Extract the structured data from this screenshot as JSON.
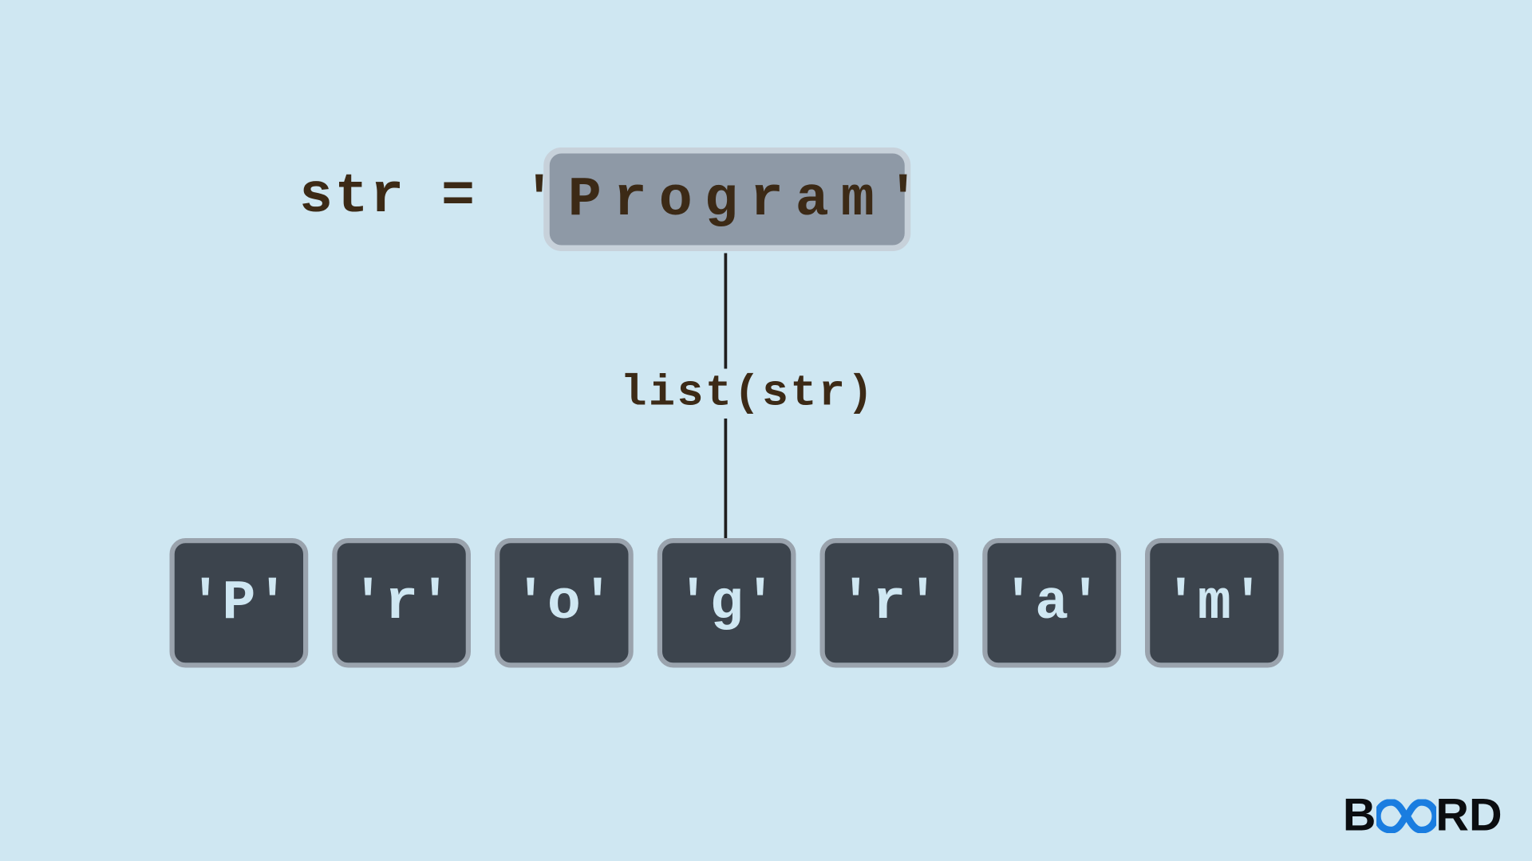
{
  "assignment_label": "str =",
  "string_value": "'Program'",
  "operation_label": "list(str)",
  "chars": [
    "'P'",
    "'r'",
    "'o'",
    "'g'",
    "'r'",
    "'a'",
    "'m'"
  ],
  "logo": {
    "lead": "B",
    "tail": "RD"
  }
}
